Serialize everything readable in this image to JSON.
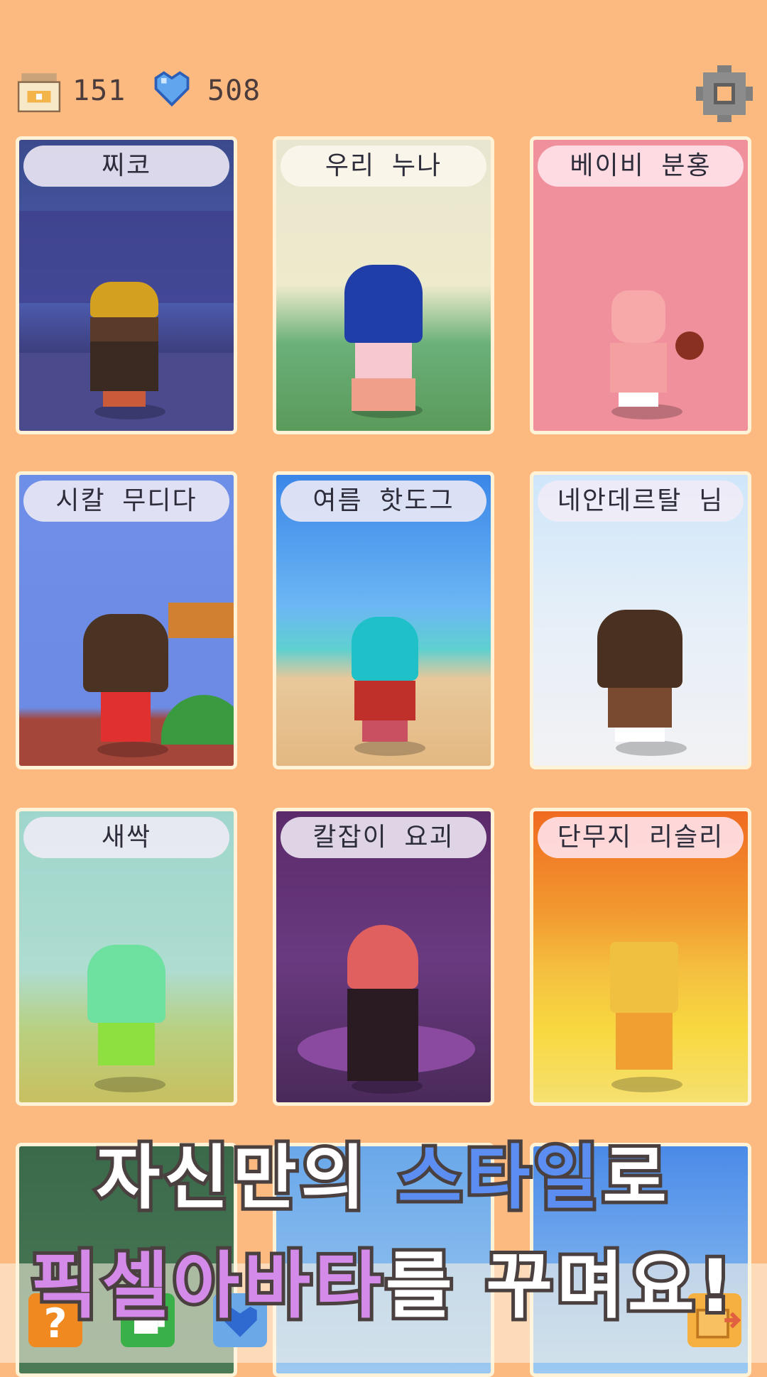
{
  "currency": {
    "coins": "151",
    "gems": "508",
    "coin_icon": "coin-jar-icon",
    "gem_icon": "heart-gem-icon",
    "settings_icon": "gear-icon"
  },
  "cards": [
    {
      "name": "찌코"
    },
    {
      "name": "우리 누나"
    },
    {
      "name": "베이비 분홍"
    },
    {
      "name": "시칼 무디다"
    },
    {
      "name": "여름 핫도그"
    },
    {
      "name": "네안데르탈 님"
    },
    {
      "name": "새싹"
    },
    {
      "name": "칼잡이 요괴"
    },
    {
      "name": "단무지 리슬리"
    }
  ],
  "headline": {
    "line1_a": "자신만의 ",
    "line1_b": "스타일",
    "line1_c": "로",
    "line2_a": "픽셀아바타",
    "line2_b": "를 꾸며요!"
  },
  "dock": {
    "help_icon": "question-icon",
    "cup_icon": "cup-icon",
    "heart_icon": "heart-icon",
    "basket_icon": "basket-arrow-icon"
  }
}
